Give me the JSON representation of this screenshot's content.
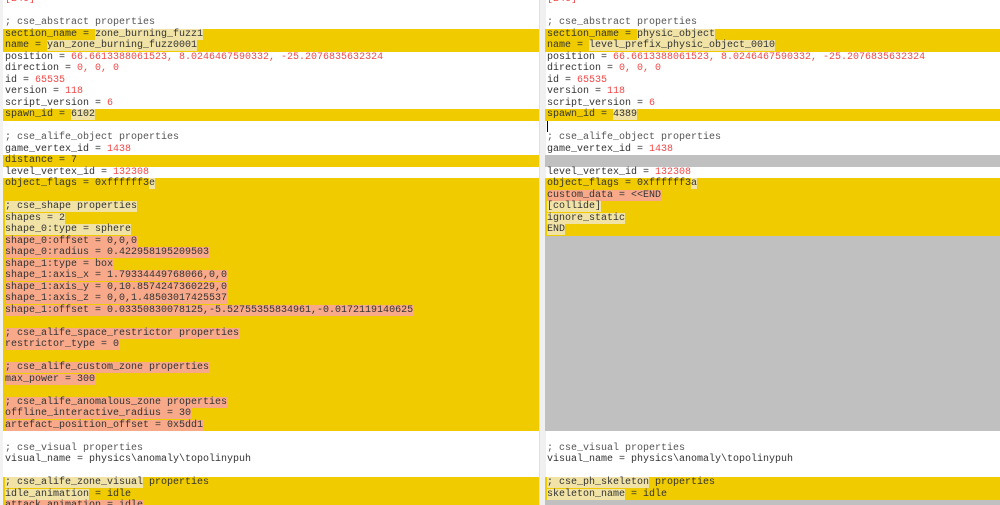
{
  "colors": {
    "diff": "#efcb00",
    "word_highlight": "#f1e3a6",
    "inserted": "#f8a98a",
    "gap": "#c0c0c0",
    "number": "#f24848"
  },
  "panes": [
    {
      "name": "left-pane",
      "lines": [
        {
          "t": "s",
          "segs": [
            [
              "[246]",
              "r"
            ]
          ]
        },
        {
          "t": "s",
          "segs": []
        },
        {
          "t": "s",
          "segs": [
            [
              "; cse_abstract properties",
              "c"
            ]
          ]
        },
        {
          "t": "d",
          "segs": [
            [
              "section_name = ",
              "n"
            ],
            [
              "zone_burning_fuzz1",
              "w"
            ]
          ]
        },
        {
          "t": "d",
          "segs": [
            [
              "name = ",
              "n"
            ],
            [
              "yan_zone_burning_fuzz0001",
              "w"
            ]
          ]
        },
        {
          "t": "s",
          "segs": [
            [
              "position = ",
              "n"
            ],
            [
              "66.6613388061523, 8.0246467590332, -25.2076835632324",
              "r"
            ]
          ]
        },
        {
          "t": "s",
          "segs": [
            [
              "direction = ",
              "n"
            ],
            [
              "0, 0, 0",
              "r"
            ]
          ]
        },
        {
          "t": "s",
          "segs": [
            [
              "id = ",
              "n"
            ],
            [
              "65535",
              "r"
            ]
          ]
        },
        {
          "t": "s",
          "segs": [
            [
              "version = ",
              "n"
            ],
            [
              "118",
              "r"
            ]
          ]
        },
        {
          "t": "s",
          "segs": [
            [
              "script_version = ",
              "n"
            ],
            [
              "6",
              "r"
            ]
          ]
        },
        {
          "t": "d",
          "segs": [
            [
              "spawn_id = ",
              "n"
            ],
            [
              "6102",
              "w"
            ]
          ]
        },
        {
          "t": "s",
          "segs": []
        },
        {
          "t": "s",
          "segs": [
            [
              "; cse_alife_object properties",
              "c"
            ]
          ]
        },
        {
          "t": "s",
          "segs": [
            [
              "game_vertex_id = ",
              "n"
            ],
            [
              "1438",
              "r"
            ]
          ]
        },
        {
          "t": "d",
          "segs": [
            [
              "distance = 7",
              "n"
            ]
          ]
        },
        {
          "t": "s",
          "segs": [
            [
              "level_vertex_id = ",
              "n"
            ],
            [
              "132308",
              "r"
            ]
          ]
        },
        {
          "t": "d",
          "segs": [
            [
              "object_flags = 0xffffff3",
              "n"
            ],
            [
              "e",
              "w"
            ]
          ]
        },
        {
          "t": "d",
          "segs": []
        },
        {
          "t": "d",
          "segs": [
            [
              "; cse_shape properties",
              "w"
            ]
          ]
        },
        {
          "t": "d",
          "segs": [
            [
              "shapes = 2",
              "w"
            ]
          ]
        },
        {
          "t": "d",
          "segs": [
            [
              "shape_0:type = sphere",
              "w"
            ]
          ]
        },
        {
          "t": "d",
          "segs": [
            [
              "shape_0:offset = 0,0,0",
              "s"
            ]
          ]
        },
        {
          "t": "d",
          "segs": [
            [
              "shape_0:radius = 0.422958195209503",
              "s"
            ]
          ]
        },
        {
          "t": "d",
          "segs": [
            [
              "shape_1:type = box",
              "s"
            ]
          ]
        },
        {
          "t": "d",
          "segs": [
            [
              "shape_1:axis_x = 1.79334449768066,0,0",
              "s"
            ]
          ]
        },
        {
          "t": "d",
          "segs": [
            [
              "shape_1:axis_y = 0,10.8574247360229,0",
              "s"
            ]
          ]
        },
        {
          "t": "d",
          "segs": [
            [
              "shape_1:axis_z = 0,0,1.48503017425537",
              "s"
            ]
          ]
        },
        {
          "t": "d",
          "segs": [
            [
              "shape_1:offset = 0.03350830078125,-5.52755355834961,-0.0172119140625",
              "s"
            ]
          ]
        },
        {
          "t": "d",
          "segs": []
        },
        {
          "t": "d",
          "segs": [
            [
              "; cse_alife_space_restrictor properties",
              "s"
            ]
          ]
        },
        {
          "t": "d",
          "segs": [
            [
              "restrictor_type = 0",
              "s"
            ]
          ]
        },
        {
          "t": "d",
          "segs": []
        },
        {
          "t": "d",
          "segs": [
            [
              "; cse_alife_custom_zone properties",
              "s"
            ]
          ]
        },
        {
          "t": "d",
          "segs": [
            [
              "max_power = 300",
              "s"
            ]
          ]
        },
        {
          "t": "d",
          "segs": []
        },
        {
          "t": "d",
          "segs": [
            [
              "; cse_alife_anomalous_zone properties",
              "s"
            ]
          ]
        },
        {
          "t": "d",
          "segs": [
            [
              "offline_interactive_radius = 30",
              "s"
            ]
          ]
        },
        {
          "t": "d",
          "segs": [
            [
              "artefact_position_offset = 0x5dd1",
              "s"
            ]
          ]
        },
        {
          "t": "s",
          "segs": []
        },
        {
          "t": "s",
          "segs": [
            [
              "; cse_visual properties",
              "c"
            ]
          ]
        },
        {
          "t": "s",
          "segs": [
            [
              "visual_name = physics\\anomaly\\topolinypuh",
              "n"
            ]
          ]
        },
        {
          "t": "s",
          "segs": []
        },
        {
          "t": "d",
          "segs": [
            [
              "; cse_alife_zone_visual",
              "w"
            ],
            [
              " properties",
              "n"
            ]
          ]
        },
        {
          "t": "d",
          "segs": [
            [
              "idle_animation",
              "w"
            ],
            [
              " = idle",
              "n"
            ]
          ]
        },
        {
          "t": "d",
          "segs": [
            [
              "attack_animation = idle",
              "s"
            ]
          ]
        }
      ]
    },
    {
      "name": "right-pane",
      "lines": [
        {
          "t": "s",
          "segs": [
            [
              "[246]",
              "r"
            ]
          ]
        },
        {
          "t": "s",
          "segs": []
        },
        {
          "t": "s",
          "segs": [
            [
              "; cse_abstract properties",
              "c"
            ]
          ]
        },
        {
          "t": "d",
          "segs": [
            [
              "section_name = ",
              "n"
            ],
            [
              "physic_object",
              "w"
            ]
          ]
        },
        {
          "t": "d",
          "segs": [
            [
              "name = ",
              "n"
            ],
            [
              "level_prefix_physic_object_0010",
              "w"
            ]
          ]
        },
        {
          "t": "s",
          "segs": [
            [
              "position = ",
              "n"
            ],
            [
              "66.6613388061523, 8.0246467590332, -25.2076835632324",
              "r"
            ]
          ]
        },
        {
          "t": "s",
          "segs": [
            [
              "direction = ",
              "n"
            ],
            [
              "0, 0, 0",
              "r"
            ]
          ]
        },
        {
          "t": "s",
          "segs": [
            [
              "id = ",
              "n"
            ],
            [
              "65535",
              "r"
            ]
          ]
        },
        {
          "t": "s",
          "segs": [
            [
              "version = ",
              "n"
            ],
            [
              "118",
              "r"
            ]
          ]
        },
        {
          "t": "s",
          "segs": [
            [
              "script_version = ",
              "n"
            ],
            [
              "6",
              "r"
            ]
          ]
        },
        {
          "t": "d",
          "segs": [
            [
              "spawn_id = ",
              "n"
            ],
            [
              "4389",
              "w"
            ]
          ]
        },
        {
          "t": "s",
          "segs": [],
          "cursor": true
        },
        {
          "t": "s",
          "segs": [
            [
              "; cse_alife_object properties",
              "c"
            ]
          ]
        },
        {
          "t": "s",
          "segs": [
            [
              "game_vertex_id = ",
              "n"
            ],
            [
              "1438",
              "r"
            ]
          ]
        },
        {
          "t": "g",
          "segs": []
        },
        {
          "t": "s",
          "segs": [
            [
              "level_vertex_id = ",
              "n"
            ],
            [
              "132308",
              "r"
            ]
          ]
        },
        {
          "t": "d",
          "segs": [
            [
              "object_flags = 0xffffff3",
              "n"
            ],
            [
              "a",
              "w"
            ]
          ]
        },
        {
          "t": "d",
          "segs": [
            [
              "custom_data = <<END",
              "s"
            ]
          ]
        },
        {
          "t": "d",
          "segs": [
            [
              "[collide]",
              "w"
            ]
          ]
        },
        {
          "t": "d",
          "segs": [
            [
              "ignore_static",
              "w"
            ]
          ]
        },
        {
          "t": "d",
          "segs": [
            [
              "END",
              "w"
            ]
          ]
        },
        {
          "t": "g",
          "segs": []
        },
        {
          "t": "g",
          "segs": []
        },
        {
          "t": "g",
          "segs": []
        },
        {
          "t": "g",
          "segs": []
        },
        {
          "t": "g",
          "segs": []
        },
        {
          "t": "g",
          "segs": []
        },
        {
          "t": "g",
          "segs": []
        },
        {
          "t": "g",
          "segs": []
        },
        {
          "t": "g",
          "segs": []
        },
        {
          "t": "g",
          "segs": []
        },
        {
          "t": "g",
          "segs": []
        },
        {
          "t": "g",
          "segs": []
        },
        {
          "t": "g",
          "segs": []
        },
        {
          "t": "g",
          "segs": []
        },
        {
          "t": "g",
          "segs": []
        },
        {
          "t": "g",
          "segs": []
        },
        {
          "t": "g",
          "segs": []
        },
        {
          "t": "s",
          "segs": []
        },
        {
          "t": "s",
          "segs": [
            [
              "; cse_visual properties",
              "c"
            ]
          ]
        },
        {
          "t": "s",
          "segs": [
            [
              "visual_name = physics\\anomaly\\topolinypuh",
              "n"
            ]
          ]
        },
        {
          "t": "s",
          "segs": []
        },
        {
          "t": "d",
          "segs": [
            [
              "; cse_ph_skeleton",
              "w"
            ],
            [
              " properties",
              "n"
            ]
          ]
        },
        {
          "t": "d",
          "segs": [
            [
              "skeleton_name",
              "w"
            ],
            [
              " = idle",
              "n"
            ]
          ]
        },
        {
          "t": "g",
          "segs": []
        }
      ]
    }
  ]
}
